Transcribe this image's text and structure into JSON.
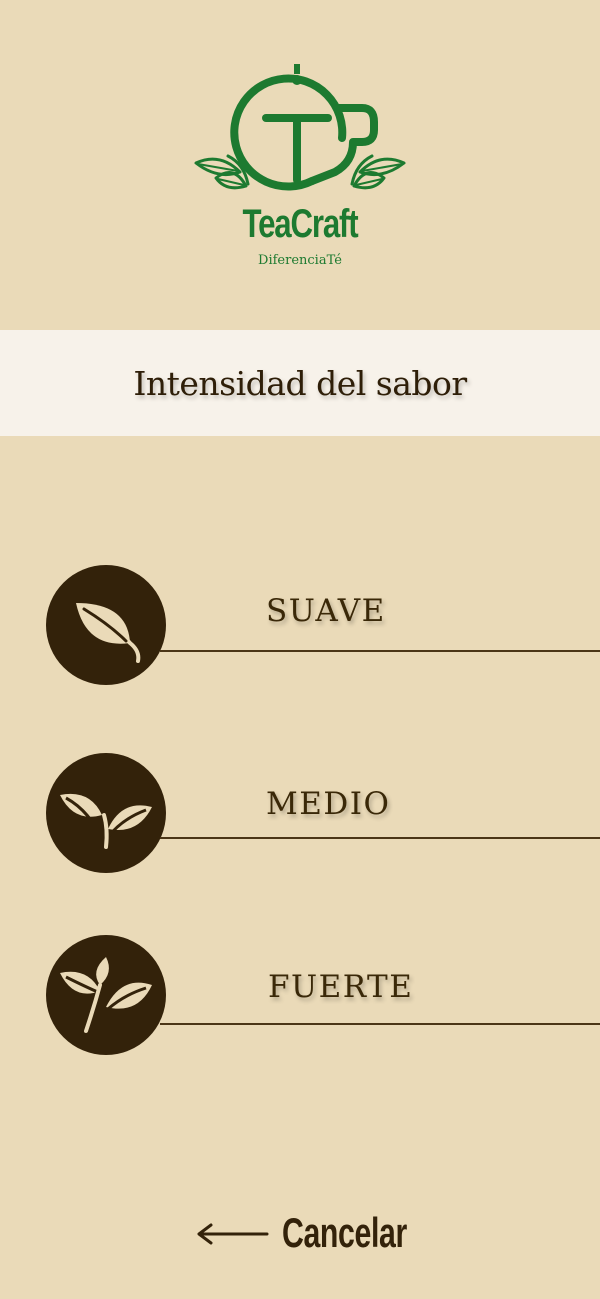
{
  "brand": {
    "name": "TeaCraft",
    "tagline": "DiferenciaTé",
    "color": "#1d7a30"
  },
  "page": {
    "title": "Intensidad del sabor"
  },
  "options": [
    {
      "label": "SUAVE",
      "icon": "single-leaf-icon"
    },
    {
      "label": "MEDIO",
      "icon": "sprout-icon"
    },
    {
      "label": "FUERTE",
      "icon": "tea-branch-icon"
    }
  ],
  "cancel": {
    "label": "Cancelar",
    "icon": "arrow-left-icon"
  },
  "colors": {
    "background": "#eadab8",
    "title_band": "#f7f2ea",
    "dark_brown": "#33220a",
    "leaf": "#eadab8"
  }
}
